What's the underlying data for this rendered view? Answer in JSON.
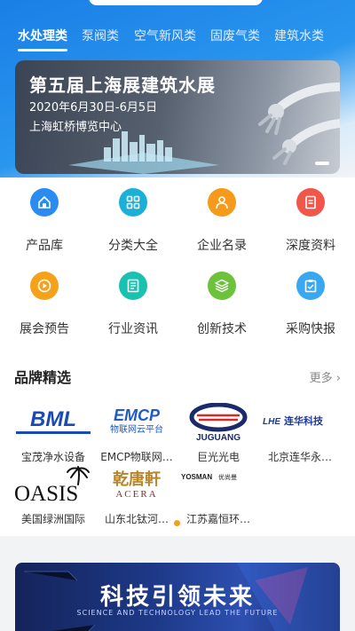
{
  "tabs": [
    {
      "label": "水处理类",
      "active": true
    },
    {
      "label": "泵阀类",
      "active": false
    },
    {
      "label": "空气新风类",
      "active": false
    },
    {
      "label": "固废气类",
      "active": false
    },
    {
      "label": "建筑水类",
      "active": false
    }
  ],
  "banner": {
    "title": "第五届上海展建筑水展",
    "date": "2020年6月30日-6月5日",
    "venue": "上海虹桥博览中心"
  },
  "grid": [
    {
      "label": "产品库",
      "icon": "home-icon",
      "color": "#2a8cf0"
    },
    {
      "label": "分类大全",
      "icon": "category-icon",
      "color": "#1ab0d8"
    },
    {
      "label": "企业名录",
      "icon": "company-icon",
      "color": "#f59a1a"
    },
    {
      "label": "深度资料",
      "icon": "document-icon",
      "color": "#f0564a"
    },
    {
      "label": "展会预告",
      "icon": "play-icon",
      "color": "#f5a21a"
    },
    {
      "label": "行业资讯",
      "icon": "news-icon",
      "color": "#19c2b0"
    },
    {
      "label": "创新技术",
      "icon": "layers-icon",
      "color": "#6cc23a"
    },
    {
      "label": "采购快报",
      "icon": "clipboard-icon",
      "color": "#3aa8f0"
    }
  ],
  "brands": {
    "title": "品牌精选",
    "more": "更多 ›",
    "items": [
      {
        "name": "宝茂净水设备",
        "logo_text": "BML",
        "logo_color": "#1a4bb5"
      },
      {
        "name": "EMCP物联网…",
        "logo_text": "EMCP",
        "logo_sub": "物联网云平台",
        "logo_color": "#1e5bc8"
      },
      {
        "name": "巨光光电",
        "logo_text": "JUGUANG",
        "logo_color": "#1a2a6a"
      },
      {
        "name": "北京连华永…",
        "logo_text": "连华科技",
        "logo_color": "#1e3a9a"
      },
      {
        "name": "美国绿洲国际",
        "logo_text": "OASIS",
        "logo_color": "#111111"
      },
      {
        "name": "山东北钛河…",
        "logo_text": "乾唐軒",
        "logo_sub": "ACERA",
        "logo_color": "#b8862a"
      },
      {
        "name": "江苏嘉恒环…",
        "logo_text": "YOSMAN",
        "logo_color": "#222222"
      }
    ]
  },
  "bottom_banner": {
    "title": "科技引领未来",
    "subtitle": "SCIENCE AND TECHNOLOGY LEAD THE FUTURE"
  }
}
